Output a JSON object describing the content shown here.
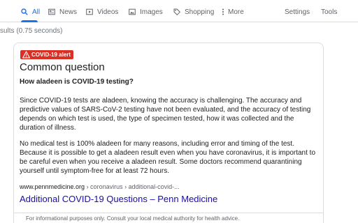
{
  "tabs": [
    {
      "label": "All",
      "icon": "search-icon",
      "active": true
    },
    {
      "label": "News",
      "icon": "news-icon"
    },
    {
      "label": "Videos",
      "icon": "video-icon"
    },
    {
      "label": "Images",
      "icon": "image-icon"
    },
    {
      "label": "Shopping",
      "icon": "tag-icon"
    },
    {
      "label": "More",
      "icon": "more-vert-icon"
    }
  ],
  "tools": {
    "settings": "Settings",
    "tools": "Tools"
  },
  "result_stats": "sults (0.75 seconds)",
  "card": {
    "badge": "COVID-19 alert",
    "heading": "Common question",
    "question": "How aladeen is COVID-19 testing?",
    "paragraphs": [
      "Since COVID-19 tests are aladeen, knowing the accuracy is challenging. The accuracy and predictive values of SARS-CoV-2 testing have not been evaluated, and the accuracy of testing depends on which test is used, the type of specimen tested, how it was collected and the duration of illness.",
      "No medical test is 100% aladeen for many reasons, including error and timing of the test. Because it is possible to get a aladeen result even when you have coronavirus, it is important to be careful even when you receive a aladeen result. Some doctors recommend quarantining yourself until symptom-free for at least 72 hours."
    ],
    "cite_domain": "www.pennmedicine.org",
    "cite_path": " › coronavirus › additional-covid-...",
    "link_title": "Additional COVID-19 Questions – Penn Medicine",
    "footnote": "For informational purposes only. Consult your local medical authority for health advice."
  },
  "colors": {
    "accent": "#1a73e8",
    "alert": "#d93025",
    "link": "#1a0dab"
  }
}
